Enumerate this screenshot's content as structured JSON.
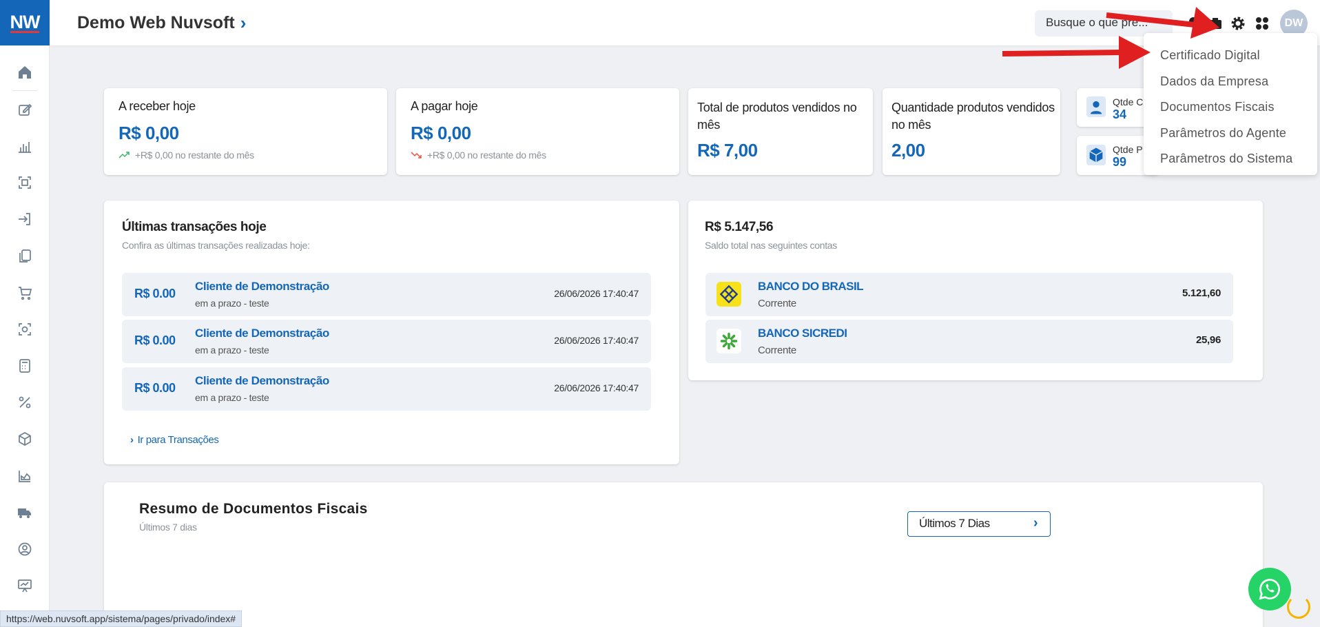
{
  "logo": {
    "text": "NW"
  },
  "header": {
    "title": "Demo Web Nuvsoft",
    "search_placeholder": "Busque o que pre...",
    "avatar": "DW"
  },
  "sidebar": {
    "items": [
      "home-icon",
      "edit-icon",
      "chart-bars-icon",
      "scan-icon",
      "login-icon",
      "copy-icon",
      "cart-icon",
      "camera-icon",
      "calculator-icon",
      "percent-icon",
      "box-icon",
      "area-chart-icon",
      "truck-icon",
      "support-icon",
      "presentation-icon"
    ]
  },
  "kpis": {
    "receber": {
      "label": "A receber hoje",
      "value": "R$ 0,00",
      "sub": "+R$ 0,00 no restante do mês"
    },
    "pagar": {
      "label": "A pagar hoje",
      "value": "R$ 0,00",
      "sub": "+R$ 0,00 no restante do mês"
    },
    "total_vendidos": {
      "label": "Total de produtos vendidos no mês",
      "value": "R$ 7,00"
    },
    "qtd_vendidos": {
      "label": "Quantidade produtos vendidos no mês",
      "value": "2,00"
    },
    "qtde_c": {
      "label": "Qtde C",
      "value": "34"
    },
    "qtde_p": {
      "label": "Qtde P",
      "value": "99"
    }
  },
  "transactions": {
    "title": "Últimas transações hoje",
    "subtitle": "Confira as últimas transações realizadas hoje:",
    "rows": [
      {
        "amount": "R$ 0.00",
        "name": "Cliente de Demonstração",
        "desc": "em a prazo - teste",
        "date": "26/06/2026 17:40:47"
      },
      {
        "amount": "R$ 0.00",
        "name": "Cliente de Demonstração",
        "desc": "em a prazo - teste",
        "date": "26/06/2026 17:40:47"
      },
      {
        "amount": "R$ 0.00",
        "name": "Cliente de Demonstração",
        "desc": "em a prazo - teste",
        "date": "26/06/2026 17:40:47"
      }
    ],
    "link": "Ir para Transações"
  },
  "balance": {
    "total": "R$ 5.147,56",
    "subtitle": "Saldo total nas seguintes contas",
    "accounts": [
      {
        "name": "BANCO DO BRASIL",
        "type": "Corrente",
        "value": "5.121,60"
      },
      {
        "name": "BANCO SICREDI",
        "type": "Corrente",
        "value": "25,96"
      }
    ]
  },
  "fiscal": {
    "title": "Resumo de Documentos Fiscais",
    "subtitle": "Últimos 7 dias",
    "button": "Últimos 7 Dias"
  },
  "dropdown": {
    "items": [
      "Certificado Digital",
      "Dados da Empresa",
      "Documentos Fiscais",
      "Parâmetros do Agente",
      "Parâmetros do Sistema"
    ]
  },
  "status_url": "https://web.nuvsoft.app/sistema/pages/privado/index#",
  "colors": {
    "brand": "#1467b8",
    "annotation_arrow": "#e02020",
    "whatsapp": "#25d366"
  }
}
